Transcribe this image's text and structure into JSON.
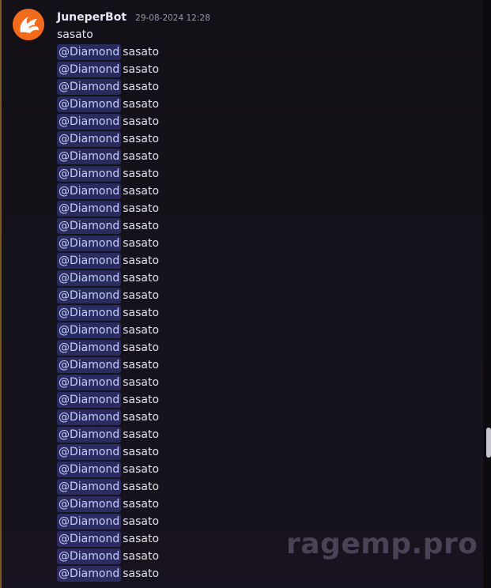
{
  "message": {
    "author": "JuneperBot",
    "timestamp": "29-08-2024 12:28",
    "first_line": "sasato",
    "mention": "@Diamond",
    "line_text": "sasato",
    "lines_count_visible": 31
  },
  "watermark": "ragemp.pro",
  "icons": {
    "avatar": "fox-avatar-icon"
  },
  "colors": {
    "accent": "#f0b232",
    "mention_bg": "#5865f2",
    "avatar_bg": "#f26a1b"
  }
}
